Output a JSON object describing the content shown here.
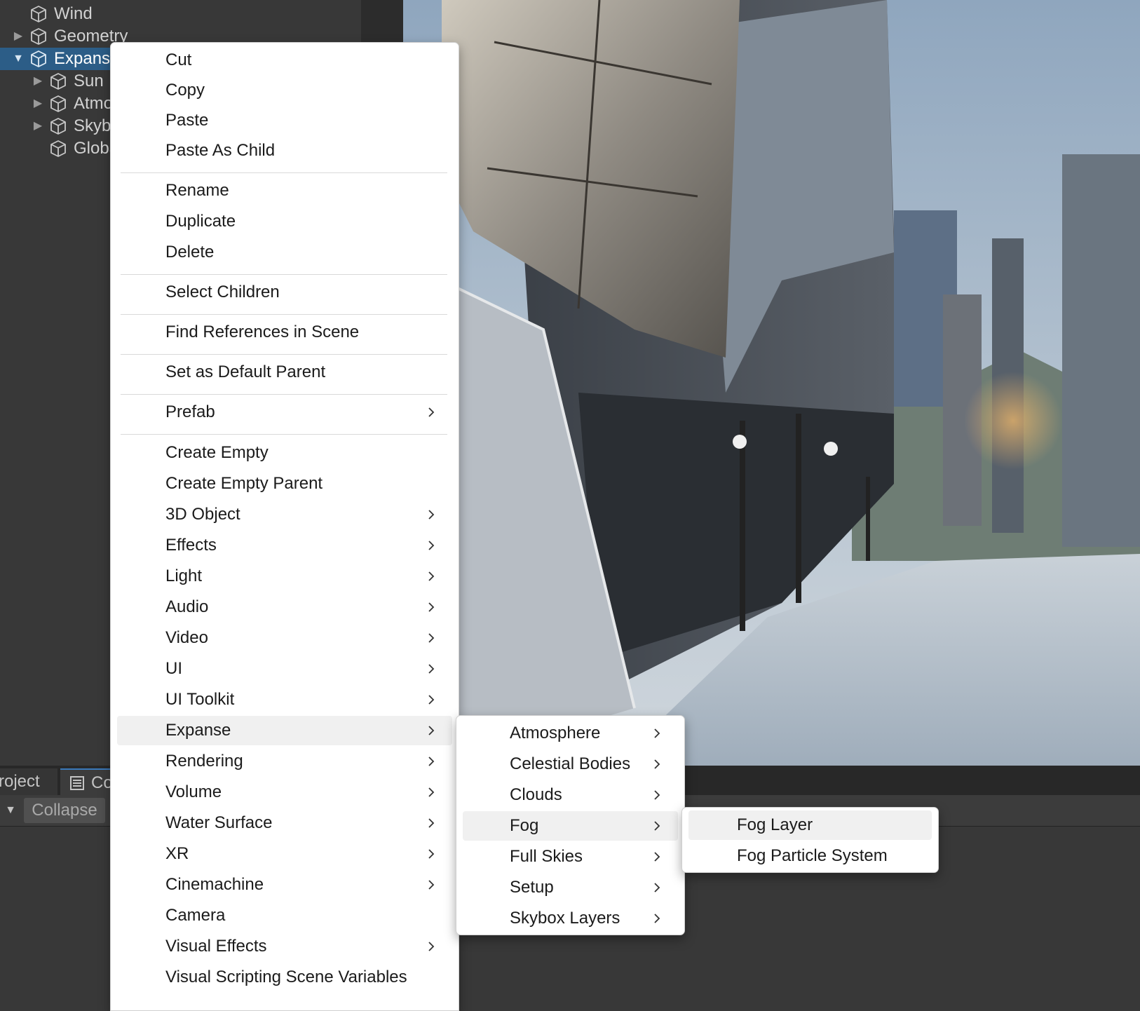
{
  "hierarchy": {
    "items": [
      {
        "label": "Wind",
        "arrow": ""
      },
      {
        "label": "Geometry",
        "arrow": "▶"
      },
      {
        "label": "Expanse",
        "arrow": "▼"
      },
      {
        "label": "Sun",
        "arrow": "▶"
      },
      {
        "label": "Atmosphere",
        "arrow": "▶"
      },
      {
        "label": "Skybox",
        "arrow": "▶"
      },
      {
        "label": "Global",
        "arrow": ""
      }
    ]
  },
  "context_menu": {
    "items": [
      {
        "label": "Cut"
      },
      {
        "label": "Copy"
      },
      {
        "label": "Paste"
      },
      {
        "label": "Paste As Child"
      },
      {
        "label": "Rename"
      },
      {
        "label": "Duplicate"
      },
      {
        "label": "Delete"
      },
      {
        "label": "Select Children"
      },
      {
        "label": "Find References in Scene"
      },
      {
        "label": "Set as Default Parent"
      },
      {
        "label": "Prefab"
      },
      {
        "label": "Create Empty"
      },
      {
        "label": "Create Empty Parent"
      },
      {
        "label": "3D Object"
      },
      {
        "label": "Effects"
      },
      {
        "label": "Light"
      },
      {
        "label": "Audio"
      },
      {
        "label": "Video"
      },
      {
        "label": "UI"
      },
      {
        "label": "UI Toolkit"
      },
      {
        "label": "Expanse"
      },
      {
        "label": "Rendering"
      },
      {
        "label": "Volume"
      },
      {
        "label": "Water Surface"
      },
      {
        "label": "XR"
      },
      {
        "label": "Cinemachine"
      },
      {
        "label": "Camera"
      },
      {
        "label": "Visual Effects"
      },
      {
        "label": "Visual Scripting Scene Variables"
      }
    ]
  },
  "expanse_submenu": {
    "items": [
      {
        "label": "Atmosphere"
      },
      {
        "label": "Celestial Bodies"
      },
      {
        "label": "Clouds"
      },
      {
        "label": "Fog"
      },
      {
        "label": "Full Skies"
      },
      {
        "label": "Setup"
      },
      {
        "label": "Skybox Layers"
      }
    ]
  },
  "fog_submenu": {
    "items": [
      {
        "label": "Fog Layer"
      },
      {
        "label": "Fog Particle System"
      }
    ]
  },
  "bottom_panel": {
    "tab_project": "Project",
    "tab_console": "Console",
    "collapse_label": "Collapse"
  },
  "colors": {
    "selection": "#2c5d87",
    "panel_bg": "#383838",
    "menu_bg": "#ffffff",
    "menu_highlight": "#f0f0f0"
  },
  "icons": {
    "gameobject": "cube-icon",
    "submenu": "chevron-right-icon",
    "console": "console-icon",
    "dropdown": "triangle-down-icon"
  }
}
